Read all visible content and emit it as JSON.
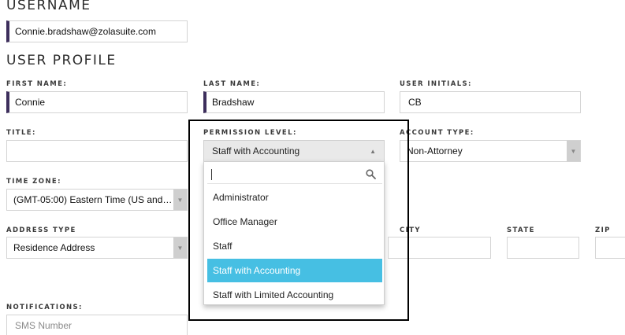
{
  "username": {
    "heading": "USERNAME",
    "value": "Connie.bradshaw@zolasuite.com"
  },
  "user_profile": {
    "heading": "USER PROFILE",
    "first_name": {
      "label": "FIRST NAME:",
      "value": "Connie"
    },
    "last_name": {
      "label": "LAST NAME:",
      "value": "Bradshaw"
    },
    "user_initials": {
      "label": "USER INITIALS:",
      "value": "CB"
    },
    "title": {
      "label": "TITLE:",
      "value": ""
    },
    "permission_level": {
      "label": "PERMISSION LEVEL:",
      "selected": "Staff with Accounting",
      "search_value": "",
      "options": [
        "Administrator",
        "Office Manager",
        "Staff",
        "Staff with Accounting",
        "Staff with Limited Accounting"
      ],
      "selected_index": 3
    },
    "account_type": {
      "label": "ACCOUNT TYPE:",
      "value": "Non-Attorney"
    },
    "time_zone": {
      "label": "TIME ZONE:",
      "value": "(GMT-05:00) Eastern Time (US and…"
    },
    "address_type": {
      "label": "ADDRESS TYPE",
      "value": "Residence Address"
    },
    "city": {
      "label": "CITY",
      "value": ""
    },
    "state": {
      "label": "STATE",
      "value": ""
    },
    "zip": {
      "label": "ZIP",
      "value": ""
    },
    "notifications": {
      "label": "NOTIFICATIONS:",
      "sms_placeholder": "SMS Number"
    }
  },
  "colors": {
    "accent_bar": "#3d2e5c",
    "dropdown_selected": "#46bfe3",
    "highlight_border": "#000000"
  },
  "icons": {
    "search": "search-icon",
    "caret_up": "caret-up-icon",
    "caret_down": "caret-down-icon"
  }
}
